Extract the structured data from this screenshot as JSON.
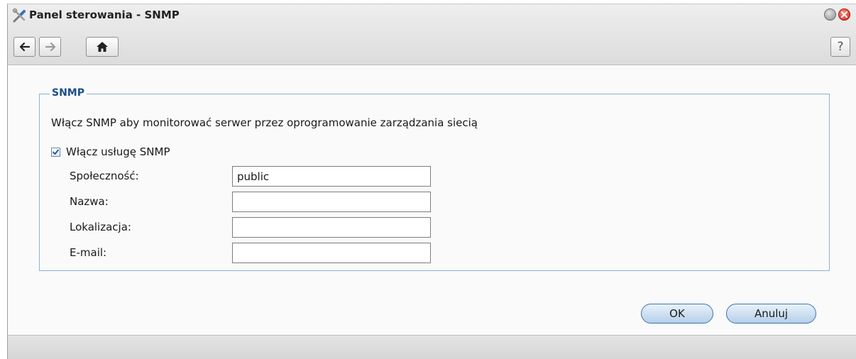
{
  "window": {
    "title": "Panel sterowania - SNMP"
  },
  "toolbar": {
    "back_icon": "arrow-left-icon",
    "forward_icon": "arrow-right-icon",
    "home_icon": "home-icon",
    "help_label": "?"
  },
  "snmp": {
    "legend": "SNMP",
    "description": "Włącz SNMP aby monitorować serwer przez oprogramowanie zarządzania siecią",
    "enable_label": "Włącz usługę SNMP",
    "enable_checked": true,
    "fields": [
      {
        "label": "Społeczność:",
        "value": "public"
      },
      {
        "label": "Nazwa:",
        "value": ""
      },
      {
        "label": "Lokalizacja:",
        "value": ""
      },
      {
        "label": "E-mail:",
        "value": ""
      }
    ]
  },
  "buttons": {
    "ok": "OK",
    "cancel": "Anuluj"
  },
  "colors": {
    "accent": "#1d4e8a",
    "fieldset_border": "#8fb1d4",
    "button_border": "#3d74ad",
    "close": "#d4251b"
  }
}
